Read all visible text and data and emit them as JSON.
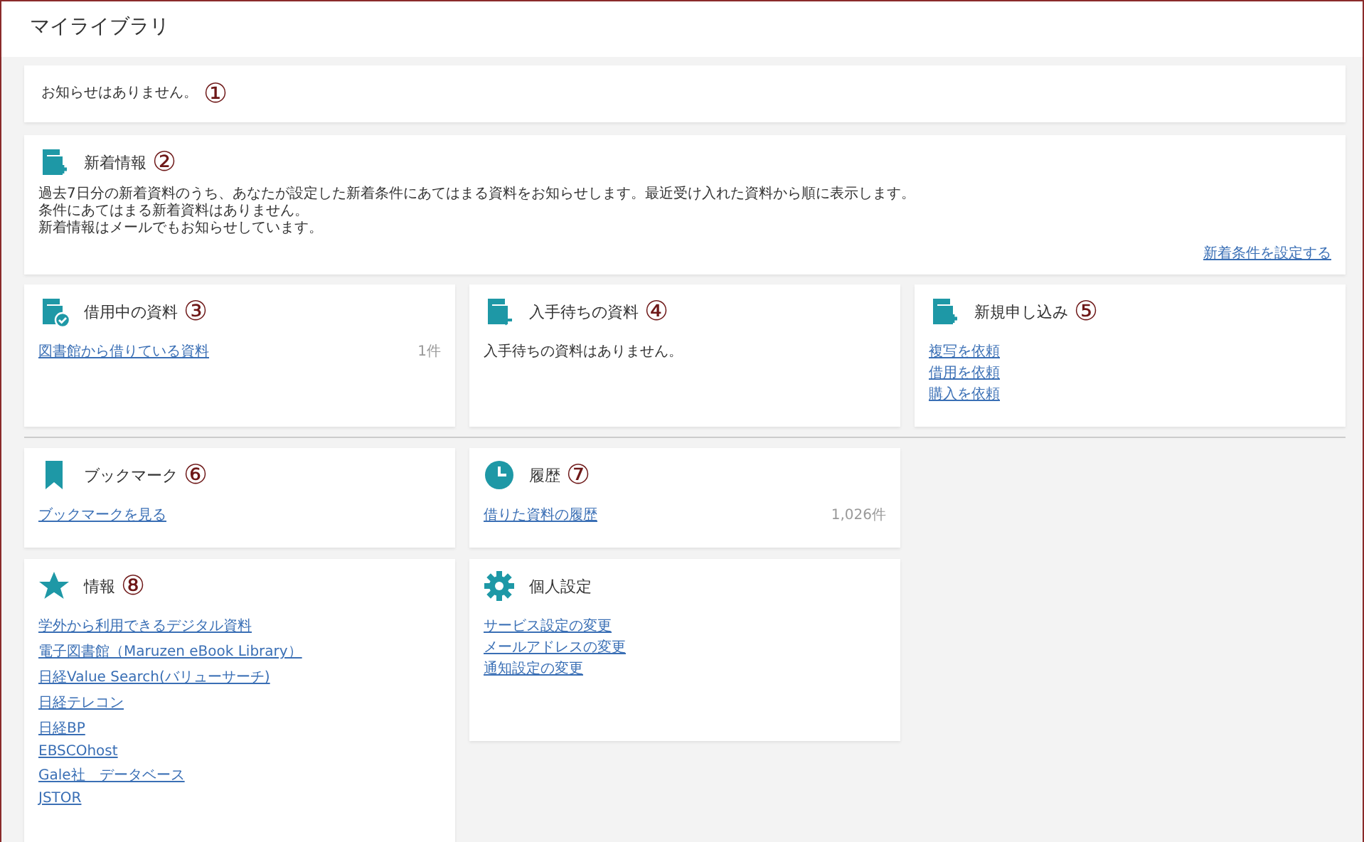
{
  "page_title": "マイライブラリ",
  "notice": {
    "text": "お知らせはありません。",
    "marker": "①"
  },
  "new_arrivals": {
    "title": "新着情報",
    "marker": "②",
    "lines": [
      "過去7日分の新着資料のうち、あなたが設定した新着条件にあてはまる資料をお知らせします。最近受け入れた資料から順に表示します。",
      "条件にあてはまる新着資料はありません。",
      "新着情報はメールでもお知らせしています。"
    ],
    "link": "新着条件を設定する"
  },
  "cards": [
    {
      "title": "借用中の資料",
      "marker": "③",
      "items": [
        {
          "kind": "link",
          "text": "図書館から借りている資料",
          "count": "1件"
        }
      ]
    },
    {
      "title": "入手待ちの資料",
      "marker": "④",
      "items": [
        {
          "kind": "text",
          "text": "入手待ちの資料はありません。"
        }
      ]
    },
    {
      "title": "新規申し込み",
      "marker": "⑤",
      "items": [
        {
          "kind": "link",
          "text": "複写を依頼"
        },
        {
          "kind": "link",
          "text": "借用を依頼"
        },
        {
          "kind": "link",
          "text": "購入を依頼"
        }
      ]
    }
  ],
  "cards2": [
    {
      "title": "ブックマーク",
      "marker": "⑥",
      "items": [
        {
          "kind": "link",
          "text": "ブックマークを見る"
        }
      ]
    },
    {
      "title": "履歴",
      "marker": "⑦",
      "items": [
        {
          "kind": "link",
          "text": "借りた資料の履歴",
          "count": "1,026件"
        }
      ]
    },
    {
      "title": "情報",
      "marker": "⑧",
      "items": [
        {
          "kind": "link",
          "text": "学外から利用できるデジタル資料"
        },
        {
          "kind": "link",
          "text": "電子図書館（Maruzen eBook Library）"
        },
        {
          "kind": "link",
          "text": "日経Value Search(バリューサーチ)"
        },
        {
          "kind": "link",
          "text": "日経テレコン"
        },
        {
          "kind": "link",
          "text": "日経BP"
        },
        {
          "kind": "link",
          "text": "EBSCOhost"
        },
        {
          "kind": "link",
          "text": "Gale社　データベース"
        },
        {
          "kind": "link",
          "text": "JSTOR"
        }
      ]
    },
    {
      "title": "個人設定",
      "items": [
        {
          "kind": "link",
          "text": "サービス設定の変更"
        },
        {
          "kind": "link",
          "text": "メールアドレスの変更"
        },
        {
          "kind": "link",
          "text": "通知設定の変更"
        }
      ]
    }
  ]
}
